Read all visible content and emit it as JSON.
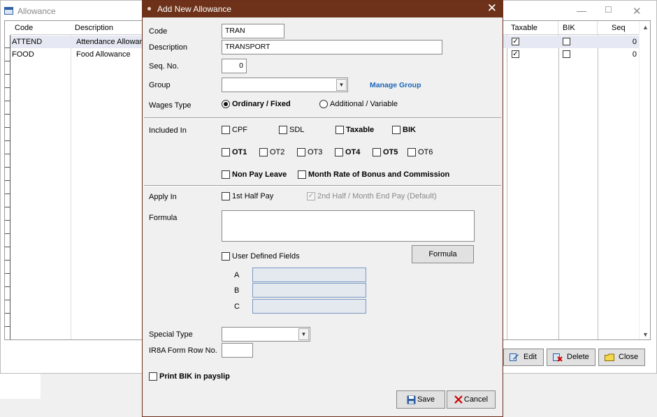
{
  "background_window": {
    "title": "Allowance",
    "columns": [
      "Code",
      "Description",
      "Taxable",
      "BIK",
      "Seq"
    ],
    "rows": [
      {
        "code": "ATTEND",
        "description": "Attendance Allowance",
        "taxable": true,
        "bik": false,
        "seq": "0"
      },
      {
        "code": "FOOD",
        "description": "Food Allowance",
        "taxable": true,
        "bik": false,
        "seq": "0"
      }
    ],
    "buttons": {
      "edit": "Edit",
      "delete": "Delete",
      "close": "Close"
    }
  },
  "dialog": {
    "title": "Add New Allowance",
    "code_label": "Code",
    "code_value": "TRAN",
    "description_label": "Description",
    "description_value": "TRANSPORT",
    "seq_label": "Seq. No.",
    "seq_value": "0",
    "group_label": "Group",
    "group_value": "",
    "manage_group": "Manage Group",
    "wages_type_label": "Wages Type",
    "wages_options": [
      {
        "label": "Ordinary / Fixed",
        "selected": true
      },
      {
        "label": "Additional / Variable",
        "selected": false
      }
    ],
    "included_in_label": "Included In",
    "included_row1": [
      {
        "label": "CPF",
        "checked": false
      },
      {
        "label": "SDL",
        "checked": false
      },
      {
        "label": "Taxable",
        "checked": false
      },
      {
        "label": "BIK",
        "checked": false
      }
    ],
    "included_row2": [
      {
        "label": "OT1",
        "checked": false
      },
      {
        "label": "OT2",
        "checked": false
      },
      {
        "label": "OT3",
        "checked": false
      },
      {
        "label": "OT4",
        "checked": false
      },
      {
        "label": "OT5",
        "checked": false
      },
      {
        "label": "OT6",
        "checked": false
      }
    ],
    "non_pay_leave": "Non Pay Leave",
    "month_rate": "Month Rate of Bonus and Commission",
    "apply_in_label": "Apply In",
    "first_half": "1st Half Pay",
    "second_half": "2nd Half / Month End Pay (Default)",
    "formula_label": "Formula",
    "formula_value": "",
    "formula_button": "Formula",
    "user_defined": "User Defined Fields",
    "udf_labels": [
      "A",
      "B",
      "C"
    ],
    "special_type_label": "Special Type",
    "special_type_value": "",
    "ir8a_label": "IR8A Form Row No.",
    "ir8a_value": "",
    "print_bik": "Print BIK in payslip",
    "save": "Save",
    "cancel": "Cancel"
  },
  "colors": {
    "titlebar": "#6d3219",
    "link": "#1b66b6"
  }
}
